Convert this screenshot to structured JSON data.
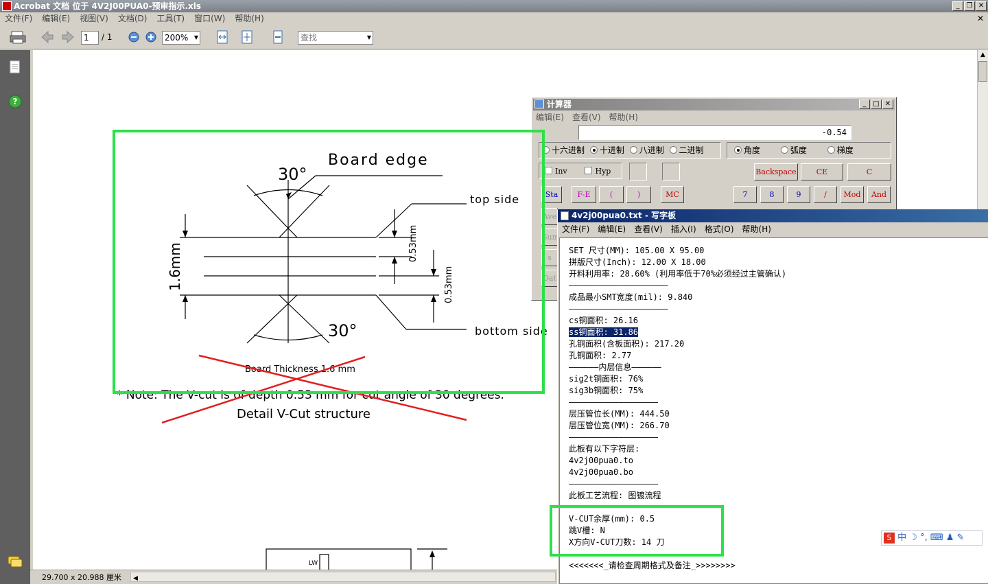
{
  "window": {
    "title": "Acrobat 文档 位于 4V2J00PUA0-预审指示.xls",
    "min": "_",
    "restore": "❐",
    "close": "✕",
    "doc_close": "✕"
  },
  "menu": [
    "文件(F)",
    "编辑(E)",
    "视图(V)",
    "文档(D)",
    "工具(T)",
    "窗口(W)",
    "帮助(H)"
  ],
  "toolbar": {
    "page_current": "1",
    "page_total": "/ 1",
    "zoom": "200%",
    "find_placeholder": "查找"
  },
  "statusbar": {
    "page_size": "29.700 x 20.988 厘米"
  },
  "drawing": {
    "board_edge": "Board edge",
    "angle_top": "30°",
    "angle_bottom": "30°",
    "top_side": "top side",
    "bottom_side": "bottom side",
    "thickness_dim": "1.6mm",
    "vcut_top_dim": "0.53mm",
    "vcut_bottom_dim": "0.53mm",
    "board_thickness": "Board Thickness 1.6 mm",
    "note": "* Note:  The V-cut is of depth 0.53 mm for cut angle of 30 degrees.",
    "detail": "Detail V-Cut structure"
  },
  "calculator": {
    "title": "计算器",
    "menu": [
      "编辑(E)",
      "查看(V)",
      "帮助(H)"
    ],
    "display": "-0.54",
    "radix": [
      "十六进制",
      "十进制",
      "八进制",
      "二进制"
    ],
    "radix_selected": 1,
    "angle": [
      "角度",
      "弧度",
      "梯度"
    ],
    "angle_selected": 0,
    "inv": "Inv",
    "hyp": "Hyp",
    "backspace": "Backspace",
    "ce": "CE",
    "c": "C",
    "row_buttons": [
      "Sta",
      "F-E",
      "(",
      ")",
      "MC",
      "7",
      "8",
      "9",
      "/",
      "Mod",
      "And"
    ],
    "side_labels": [
      "Ave",
      "Sum",
      "s",
      "Dat"
    ]
  },
  "wordpad": {
    "title": "4v2j00pua0.txt - 写字板",
    "menu": [
      "文件(F)",
      "编辑(E)",
      "查看(V)",
      "插入(I)",
      "格式(O)",
      "帮助(H)"
    ],
    "lines": [
      "SET 尺寸(MM): 105.00 X 95.00",
      "拼版尺寸(Inch): 12.00 X 18.00",
      "开料利用率: 28.60% (利用率低于70%必须经过主管确认)",
      "————————————————————",
      "成品最小SMT宽度(mil): 9.840",
      "————————————————————",
      "cs铜面积: 26.16",
      "ss铜面积: 31.86",
      "孔铜面积(含板面积): 217.20",
      "孔铜面积: 2.77",
      "——————内层信息——————",
      "sig2t铜面积: 76%",
      "sig3b铜面积: 75%",
      "——————————————————",
      "层压管位长(MM): 444.50",
      "层压管位宽(MM): 266.70",
      "——————————————————",
      "此板有以下字符层:",
      "4v2j00pua0.to",
      "4v2j00pua0.bo",
      "——————————————————",
      "此板工艺流程: 图镀流程",
      "",
      "V-CUT余厚(mm): 0.5",
      "跳V槽: N",
      "X方向V-CUT刀数: 14 刀",
      "——————————————————",
      "<<<<<<<_请检查周期格式及备注_>>>>>>>>"
    ],
    "highlight_line": 7,
    "highlight_text": "ss铜面积: 31.86"
  },
  "ime": {
    "label": "中"
  },
  "colors": {
    "highlight": "#2de04a",
    "cross": "#e02020",
    "selection": "#0a246a"
  }
}
